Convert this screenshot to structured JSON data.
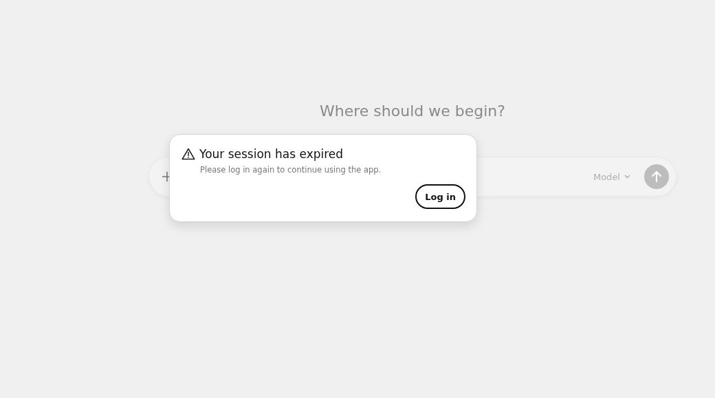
{
  "heading": "Where should we begin?",
  "composer": {
    "model_label": "Model"
  },
  "dialog": {
    "title": "Your session has expired",
    "message": "Please log in again to continue using the app.",
    "button": "Log in"
  }
}
